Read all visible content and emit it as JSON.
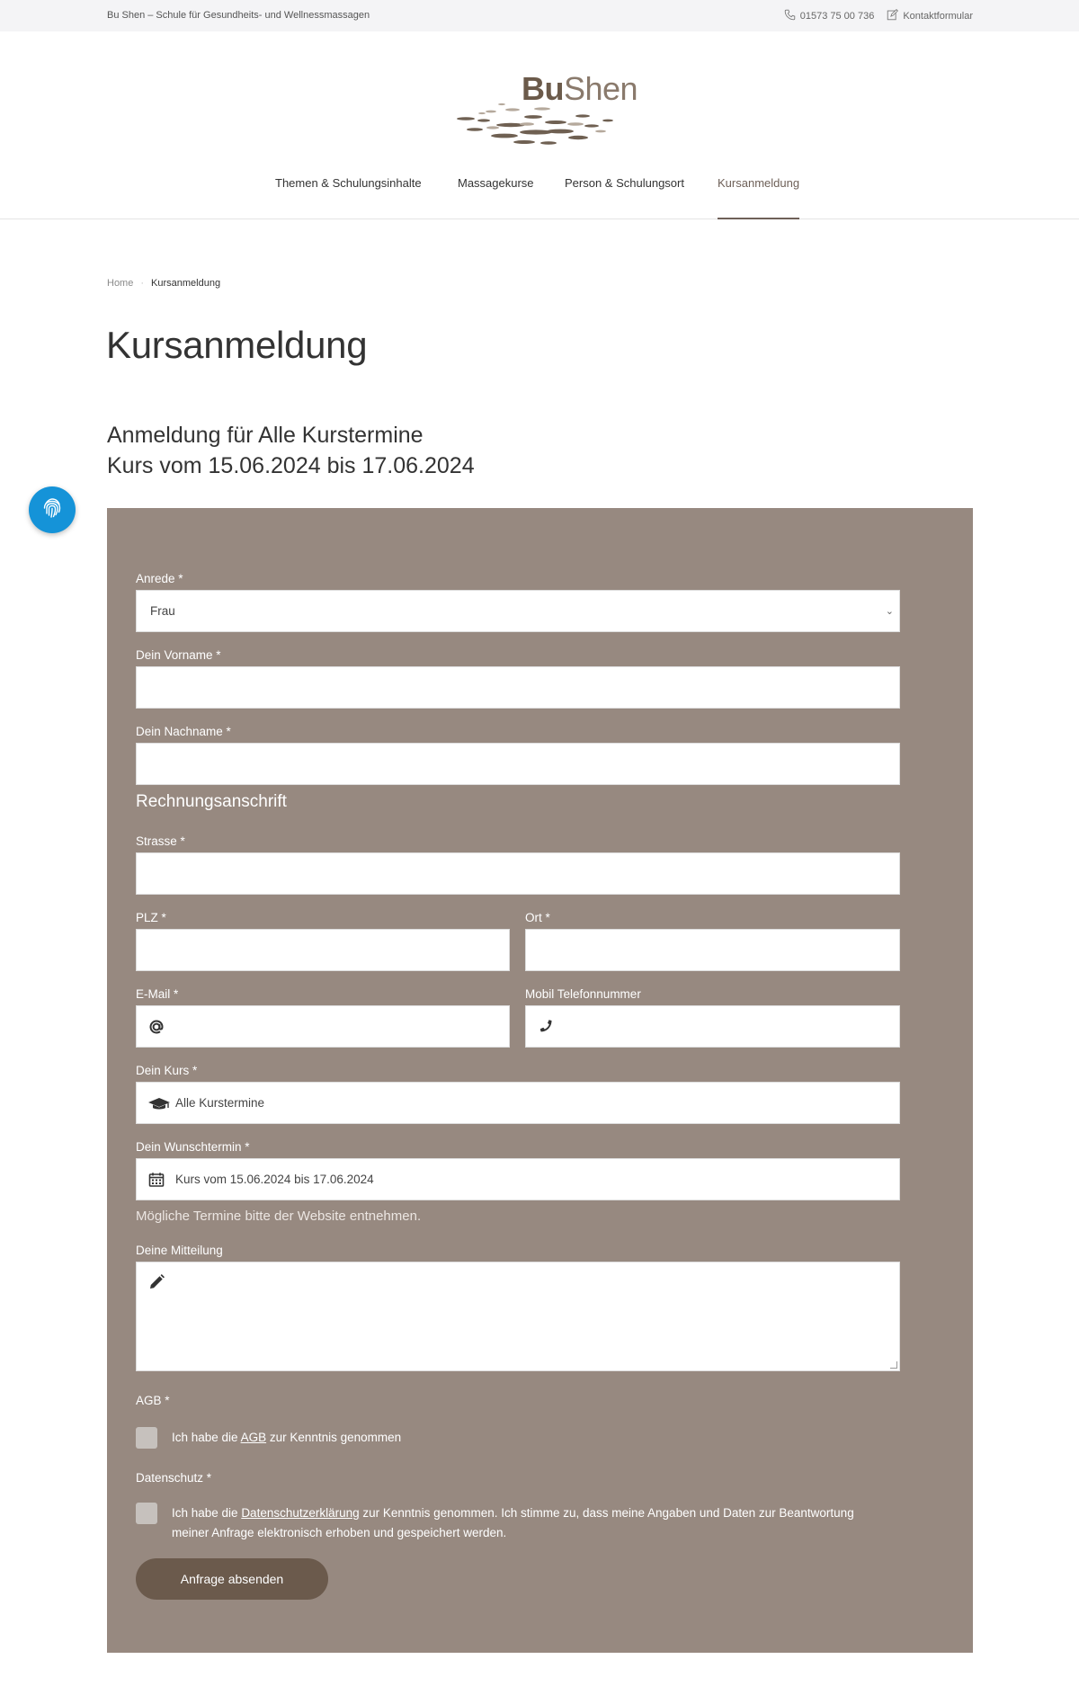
{
  "topbar": {
    "tagline": "Bu Shen – Schule für Gesundheits- und Wellnessmassagen",
    "phone": "01573 75 00 736",
    "contact": "Kontaktformular"
  },
  "logo": {
    "bu": "Bu",
    "shen": "Shen"
  },
  "nav": {
    "items": [
      {
        "label": "Themen & Schulungsinhalte"
      },
      {
        "label": "Massagekurse"
      },
      {
        "label": "Person & Schulungsort"
      },
      {
        "label": "Kursanmeldung"
      }
    ]
  },
  "breadcrumb": {
    "home": "Home",
    "current": "Kursanmeldung"
  },
  "page": {
    "title": "Kursanmeldung",
    "subtitle_line1": "Anmeldung für Alle Kurstermine",
    "subtitle_line2": "Kurs vom 15.06.2024 bis 17.06.2024"
  },
  "form": {
    "anrede_label": "Anrede  *",
    "anrede_value": "Frau",
    "vorname_label": "Dein Vorname  *",
    "nachname_label": "Dein Nachname  *",
    "section_billing": "Rechnungsanschrift",
    "strasse_label": "Strasse  *",
    "plz_label": "PLZ  *",
    "ort_label": "Ort  *",
    "email_label": "E-Mail  *",
    "phone_label": "Mobil Telefonnummer",
    "kurs_label": "Dein Kurs  *",
    "kurs_value": "Alle Kurstermine",
    "termin_label": "Dein Wunschtermin  *",
    "termin_value": "Kurs vom 15.06.2024 bis 17.06.2024",
    "hint": "Mögliche Termine bitte der Website entnehmen.",
    "mitteilung_label": "Deine Mitteilung",
    "agb_label": "AGB  *",
    "agb_text_pre": "Ich habe die ",
    "agb_link": "AGB",
    "agb_text_post": " zur Kenntnis genommen",
    "ds_label": "Datenschutz  *",
    "ds_text_pre": "Ich habe die ",
    "ds_link": "Datenschutzerklärung",
    "ds_text_post": " zur Kenntnis genommen. Ich stimme zu, dass meine Angaben und Daten zur Beantwortung",
    "ds_text_line2": "meiner Anfrage elektronisch erhoben und gespeichert werden.",
    "submit_label": "Anfrage absenden"
  },
  "icons": {
    "phone": "phone-icon",
    "edit": "edit-icon",
    "fingerprint": "fingerprint-icon",
    "at": "at-icon",
    "graduation": "graduation-cap-icon",
    "calendar": "calendar-icon",
    "pencil": "pencil-icon",
    "chevron": "chevron-down-icon"
  },
  "colors": {
    "form_bg": "#978980",
    "button_bg": "#6b5a4c",
    "accessibility_blue": "#1593d8",
    "nav_active": "#6e6058"
  }
}
